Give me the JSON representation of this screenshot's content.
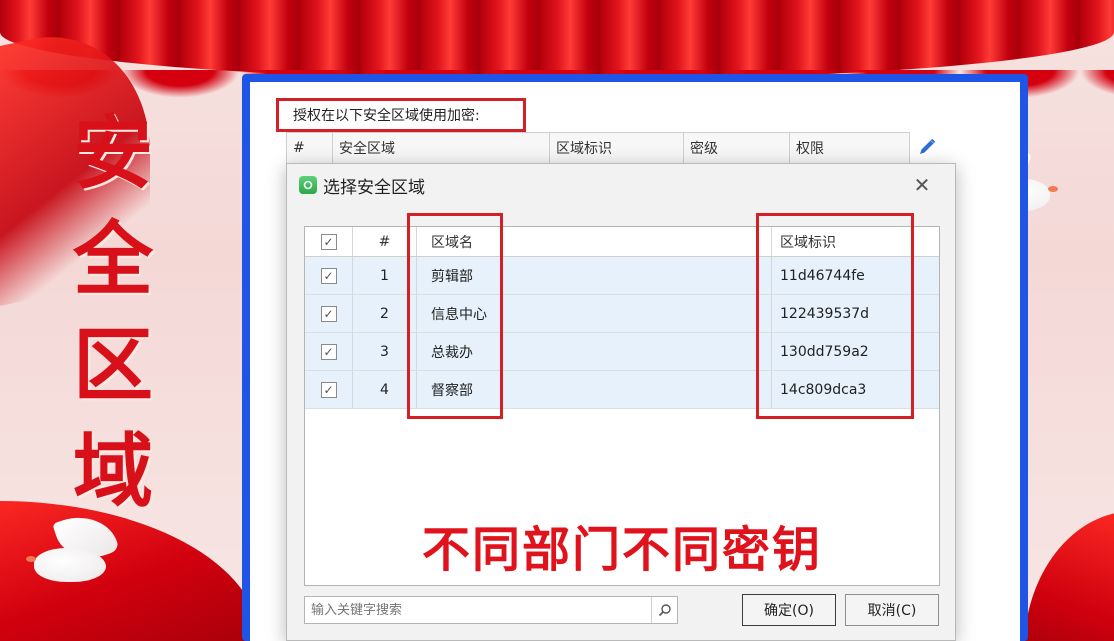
{
  "banner": {
    "vertical_title": [
      "安",
      "全",
      "区",
      "域"
    ]
  },
  "outer_window": {
    "label": "授权在以下安全区域使用加密:",
    "columns": [
      "#",
      "安全区域",
      "区域标识",
      "密级",
      "权限"
    ],
    "edit_icon": "pencil-icon"
  },
  "dialog": {
    "title": "选择安全区域",
    "close_symbol": "✕",
    "header": {
      "check": "✓",
      "num": "#",
      "name": "区域名",
      "id": "区域标识"
    },
    "rows": [
      {
        "num": "1",
        "name": "剪辑部",
        "id": "11d46744fe",
        "checked": true
      },
      {
        "num": "2",
        "name": "信息中心",
        "id": "122439537d",
        "checked": true
      },
      {
        "num": "3",
        "name": "总裁办",
        "id": "130dd759a2",
        "checked": true
      },
      {
        "num": "4",
        "name": "督察部",
        "id": "14c809dca3",
        "checked": true
      }
    ],
    "caption": "不同部门不同密钥",
    "search_placeholder": "输入关键字搜索",
    "ok_label": "确定(O)",
    "cancel_label": "取消(C)"
  },
  "colors": {
    "frame_blue": "#1f55e6",
    "highlight_red": "#d31f26",
    "row_selected": "#e6f1fb",
    "title_red": "#d8101a"
  }
}
